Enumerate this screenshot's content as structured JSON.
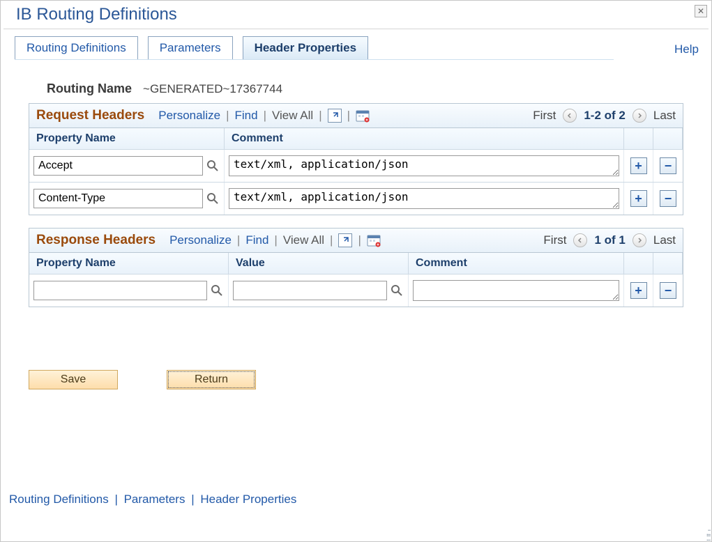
{
  "window": {
    "title": "IB Routing Definitions",
    "help": "Help"
  },
  "tabs": [
    {
      "label": "Routing Definitions",
      "active": false
    },
    {
      "label": "Parameters",
      "active": false
    },
    {
      "label": "Header Properties",
      "active": true
    }
  ],
  "routing": {
    "label": "Routing Name",
    "value": "~GENERATED~17367744"
  },
  "request_grid": {
    "title": "Request Headers",
    "tools": {
      "personalize": "Personalize",
      "find": "Find",
      "view_all": "View All"
    },
    "nav": {
      "first": "First",
      "last": "Last",
      "range": "1-2 of 2"
    },
    "columns": {
      "property": "Property Name",
      "comment": "Comment"
    },
    "rows": [
      {
        "property": "Accept",
        "comment": "text/xml, application/json"
      },
      {
        "property": "Content-Type",
        "comment": "text/xml, application/json"
      }
    ]
  },
  "response_grid": {
    "title": "Response Headers",
    "tools": {
      "personalize": "Personalize",
      "find": "Find",
      "view_all": "View All"
    },
    "nav": {
      "first": "First",
      "last": "Last",
      "range": "1 of 1"
    },
    "columns": {
      "property": "Property Name",
      "value": "Value",
      "comment": "Comment"
    },
    "rows": [
      {
        "property": "",
        "value": "",
        "comment": ""
      }
    ]
  },
  "buttons": {
    "save": "Save",
    "return": "Return"
  },
  "footer_links": [
    "Routing Definitions",
    "Parameters",
    "Header Properties"
  ]
}
